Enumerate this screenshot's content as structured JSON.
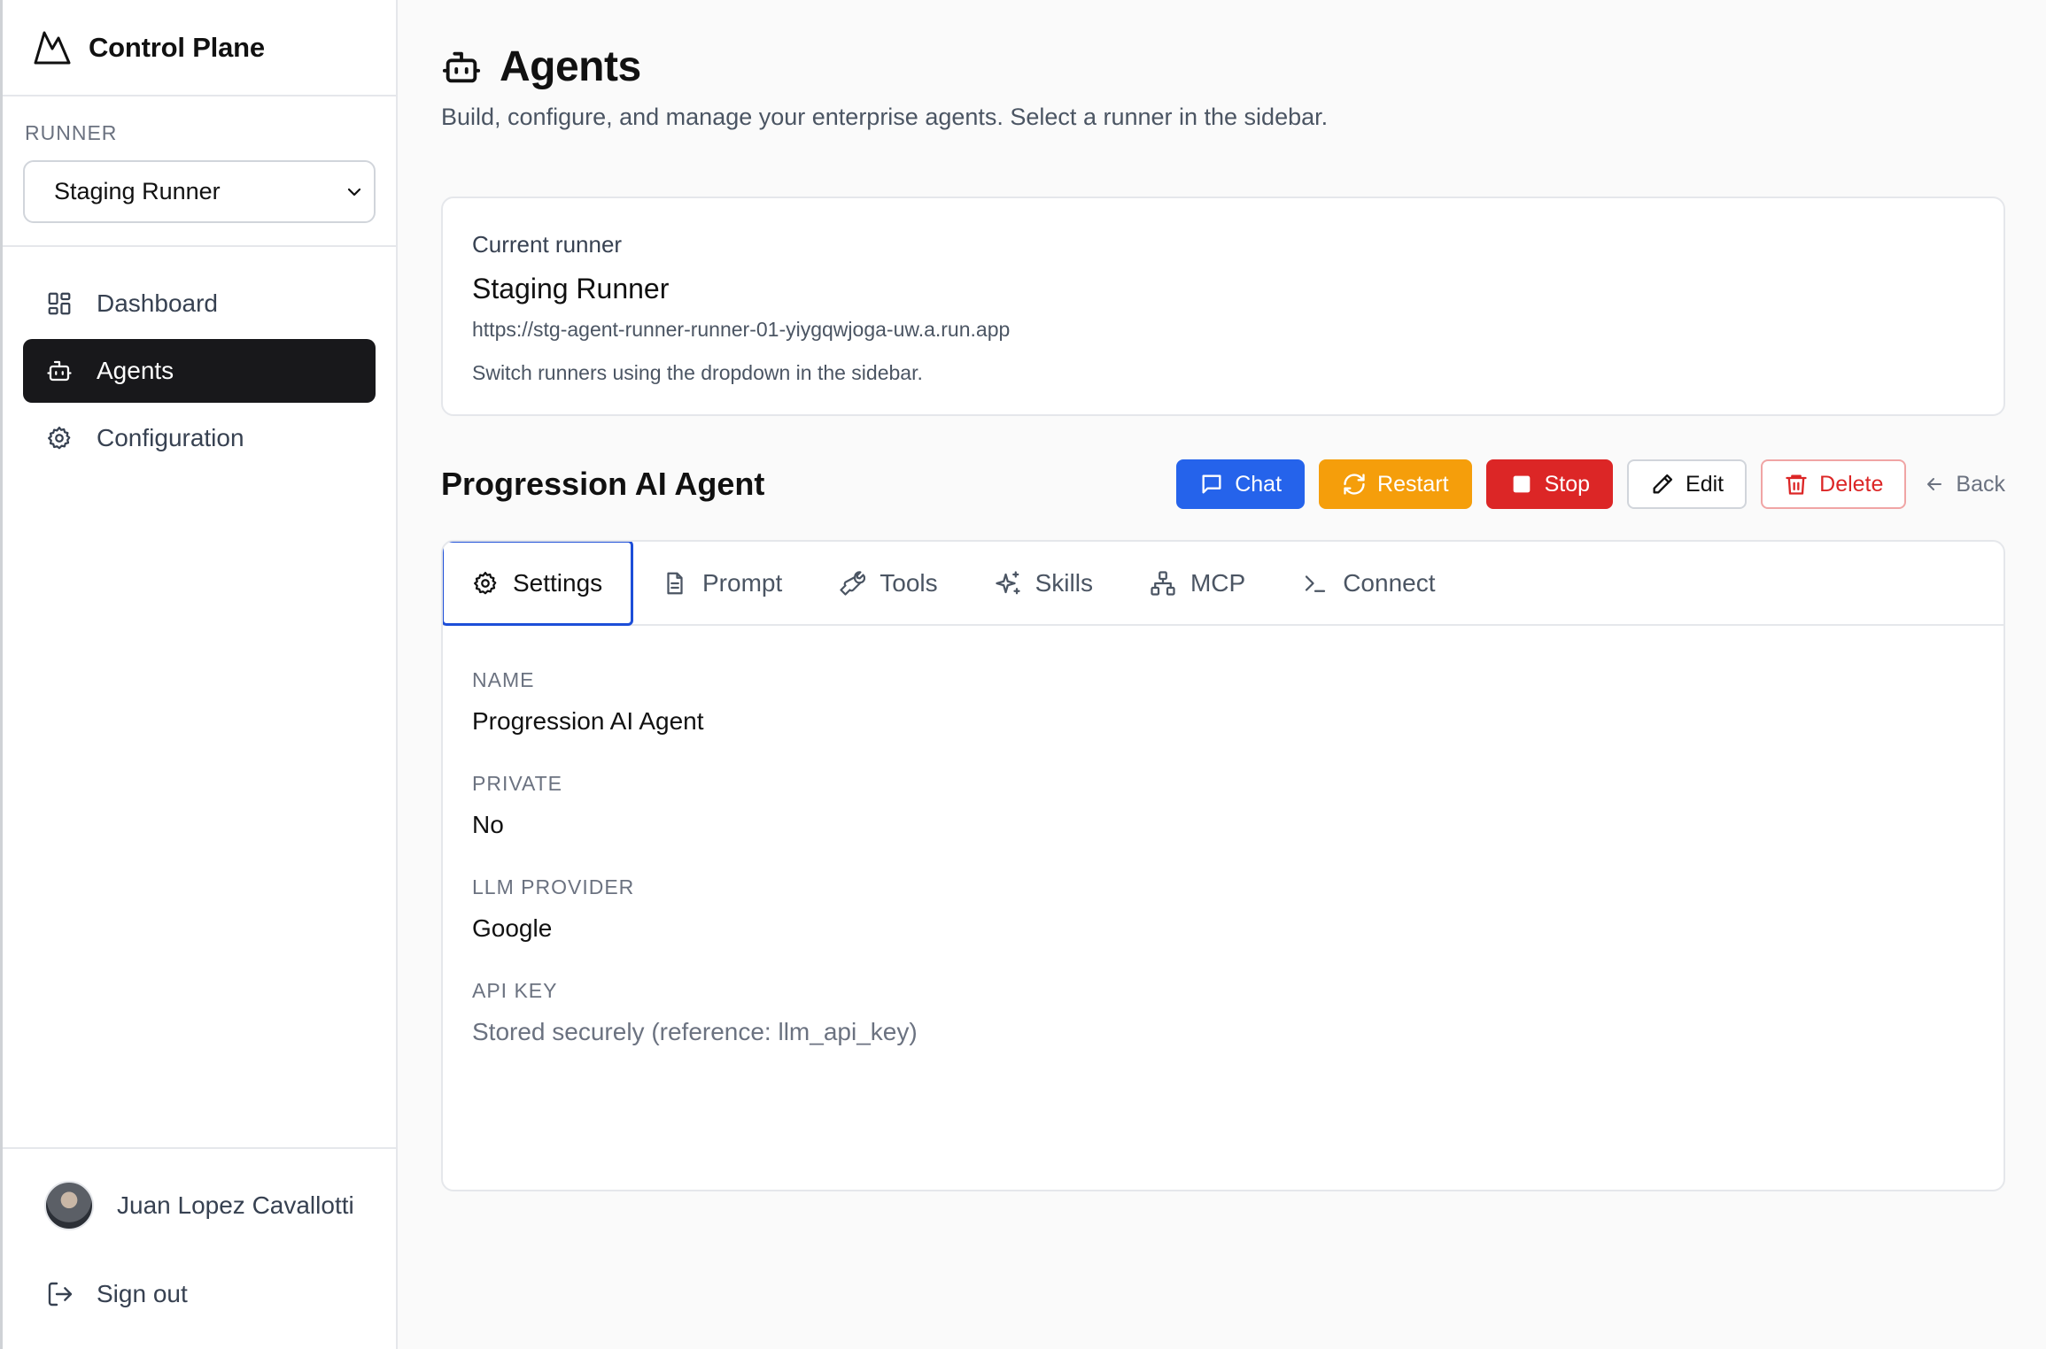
{
  "app": {
    "name": "Control Plane"
  },
  "sidebar": {
    "runner_label": "RUNNER",
    "runner_selected": "Staging Runner",
    "items": [
      {
        "label": "Dashboard",
        "icon": "dashboard-icon",
        "active": false
      },
      {
        "label": "Agents",
        "icon": "bot-icon",
        "active": true
      },
      {
        "label": "Configuration",
        "icon": "gear-icon",
        "active": false
      }
    ],
    "user_name": "Juan Lopez Cavallotti",
    "signout_label": "Sign out"
  },
  "page": {
    "title": "Agents",
    "subtitle": "Build, configure, and manage your enterprise agents. Select a runner in the sidebar."
  },
  "runner_card": {
    "label": "Current runner",
    "name": "Staging Runner",
    "url": "https://stg-agent-runner-runner-01-yiygqwjoga-uw.a.run.app",
    "hint": "Switch runners using the dropdown in the sidebar."
  },
  "agent": {
    "name": "Progression AI Agent",
    "actions": {
      "chat": "Chat",
      "restart": "Restart",
      "stop": "Stop",
      "edit": "Edit",
      "delete": "Delete",
      "back": "Back"
    },
    "tabs": [
      {
        "label": "Settings",
        "icon": "gear-icon",
        "active": true
      },
      {
        "label": "Prompt",
        "icon": "document-icon",
        "active": false
      },
      {
        "label": "Tools",
        "icon": "wrench-icon",
        "active": false
      },
      {
        "label": "Skills",
        "icon": "sparkles-icon",
        "active": false
      },
      {
        "label": "MCP",
        "icon": "network-icon",
        "active": false
      },
      {
        "label": "Connect",
        "icon": "terminal-icon",
        "active": false
      }
    ],
    "fields": [
      {
        "label": "NAME",
        "value": "Progression AI Agent"
      },
      {
        "label": "PRIVATE",
        "value": "No"
      },
      {
        "label": "LLM PROVIDER",
        "value": "Google"
      },
      {
        "label": "API KEY",
        "value": "Stored securely (reference: llm_api_key)"
      }
    ]
  },
  "colors": {
    "primary": "#2563eb",
    "warning": "#f59e0b",
    "danger": "#dc2626",
    "nav_active": "#18181b",
    "tab_focus": "#1d4ed8"
  }
}
